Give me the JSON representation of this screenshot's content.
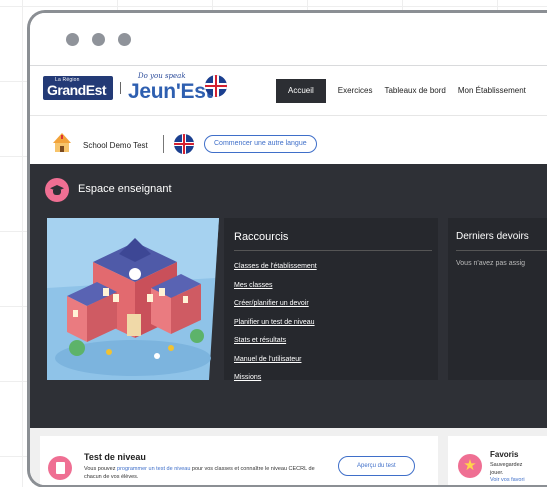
{
  "nav": {
    "logo_small": "La Région",
    "logo_main": "GrandEst",
    "brand_tagline": "Do you speak",
    "brand_name": "Jeun'Est",
    "items": [
      {
        "label": "Accueil",
        "active": true
      },
      {
        "label": "Exercices",
        "active": false
      },
      {
        "label": "Tableaux de bord",
        "active": false
      },
      {
        "label": "Mon Établissement",
        "active": false
      }
    ]
  },
  "subbar": {
    "school": "School Demo Test",
    "change_language": "Commencer une autre langue"
  },
  "teacher_space": {
    "title": "Espace enseignant",
    "shortcuts_title": "Raccourcis",
    "shortcuts": [
      "Classes de l'établissement",
      "Mes classes",
      "Créer/planifier un devoir",
      "Planifier un test de niveau",
      "Stats et résultats",
      "Manuel de l'utilisateur",
      "Missions"
    ],
    "last_homework_title": "Derniers devoirs",
    "last_homework_text": "Vous n'avez pas assig"
  },
  "cards": {
    "level_test": {
      "title": "Test de niveau",
      "desc_before": "Vous pouvez ",
      "desc_link": "programmer un test de niveau",
      "desc_after": " pour vos classes et connaître le niveau CECRL de chacun de vos élèves.",
      "button": "Aperçu du test"
    },
    "favorites": {
      "title": "Favoris",
      "desc_line1": "Sauvegardez",
      "desc_line2": "jouer.",
      "link": "Voir vos favori"
    }
  },
  "colors": {
    "dark_bg": "#2e3036",
    "accent_pink": "#ef6f93",
    "link_blue": "#3f6fc9",
    "region_blue": "#233a76"
  }
}
